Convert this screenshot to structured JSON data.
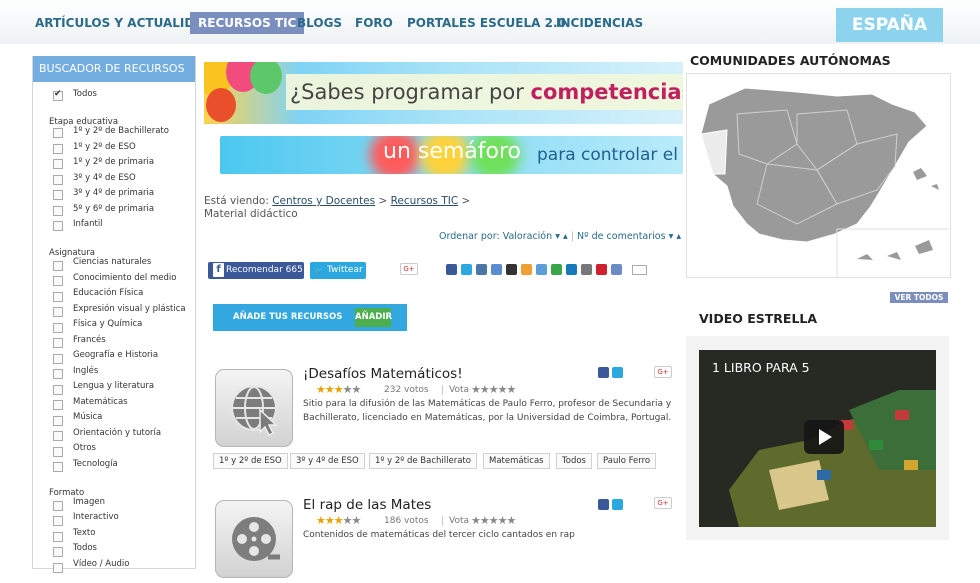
{
  "nav": {
    "items": [
      "ARTÍCULOS Y ACTUALIDAD",
      "RECURSOS TIC",
      "BLOGS",
      "FORO",
      "PORTALES ESCUELA 2.0",
      "INCIDENCIAS"
    ],
    "active": "RECURSOS TIC",
    "region": "ESPAÑA"
  },
  "sidebar": {
    "title": "BUSCADOR DE RECURSOS",
    "all_label": "Todos",
    "etapa_label": "Etapa educativa",
    "etapa": [
      "1º y 2º de Bachillerato",
      "1º y 2º de ESO",
      "1º y 2º de primaria",
      "3º y 4º de ESO",
      "3º y 4º de primaria",
      "5º y 6º de primaria",
      "Infantil"
    ],
    "asignatura_label": "Asignatura",
    "asignatura": [
      "Ciencias naturales",
      "Conocimiento del medio",
      "Educación Física",
      "Expresión visual y plástica",
      "Física y Química",
      "Francés",
      "Geografía e Historia",
      "Inglés",
      "Lengua y literatura",
      "Matemáticas",
      "Música",
      "Orientación y tutoría",
      "Otros",
      "Tecnología"
    ],
    "formato_label": "Formato",
    "formato": [
      "Imagen",
      "Interactivo",
      "Texto",
      "Todos",
      "Vídeo / Audio"
    ]
  },
  "banners": {
    "b1_text": "¿Sabes programar por ",
    "b1_highlight": "competencias?",
    "b2_text1": "un semáforo",
    "b2_text2": "para controlar el"
  },
  "breadcrumb": {
    "prefix": "Está viendo:",
    "items": [
      "Centros y Docentes",
      "Recursos TIC"
    ],
    "current": "Material didáctico",
    "sep": ">"
  },
  "order": {
    "label": "Ordenar por:",
    "opt1": "Valoración",
    "opt2": "Nº de comentarios"
  },
  "share": {
    "fb_label": "Recomendar 665",
    "tw_label": "Twittear",
    "gplus": "G+"
  },
  "add_resources": {
    "label": "AÑADE TUS RECURSOS",
    "button": "AÑADIR"
  },
  "resources": [
    {
      "title": "¡Desafíos Matemáticos!",
      "votes": "232 votos",
      "vote_label": "Vota",
      "rating": 3,
      "description": "Sitio para la difusión de las Matemáticas de Paulo Ferro, profesor de Secundaria y Bachillerato, licenciado en Matemáticas, por la Universidad de Coimbra, Portugal.",
      "tags": [
        "1º y 2º de ESO",
        "3º y 4º de ESO",
        "1º y 2º de Bachillerato",
        "Matemáticas",
        "Todos",
        "Paulo Ferro"
      ],
      "icon": "globe-cursor-icon"
    },
    {
      "title": "El rap de las Mates",
      "votes": "186 votos",
      "vote_label": "Vota",
      "rating": 3,
      "description": "Contenidos de matemáticas del tercer ciclo cantados en rap",
      "icon": "film-reel-icon"
    }
  ],
  "right": {
    "communities_title": "COMUNIDADES AUTÓNOMAS",
    "see_all": "VER TODOS",
    "video_title": "VIDEO ESTRELLA",
    "video_caption": "1 LIBRO PARA 5"
  },
  "colors": {
    "nav_text": "#2a6b8a",
    "nav_active_bg": "#7a8fbe",
    "region_bg": "#8dd3ee",
    "sidebar_head": "#74aee0",
    "add_bg": "#33a7e0",
    "add_btn": "#4cae4c",
    "highlight": "#c0205f"
  }
}
